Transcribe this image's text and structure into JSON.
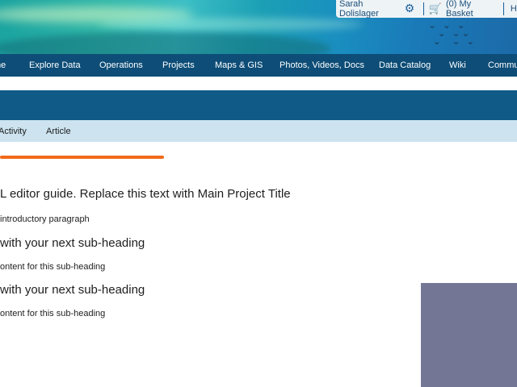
{
  "header": {
    "user_name": "Sarah Dolislager",
    "basket_label": "(0) My Basket",
    "help_label": "He",
    "icons": {
      "settings": "gear-icon",
      "cart": "cart-icon"
    }
  },
  "main_nav": {
    "items": [
      {
        "label": "me"
      },
      {
        "label": "Explore Data"
      },
      {
        "label": "Operations"
      },
      {
        "label": "Projects"
      },
      {
        "label": "Maps & GIS"
      },
      {
        "label": "Photos, Videos, Docs"
      },
      {
        "label": "Data Catalog"
      },
      {
        "label": "Wiki"
      },
      {
        "label": "Commu"
      }
    ]
  },
  "sub_nav": {
    "items": [
      {
        "label": "Activity"
      },
      {
        "label": "Article"
      }
    ]
  },
  "content": {
    "main_heading": "L editor guide. Replace this text with Main Project Title",
    "intro": "introductory paragraph",
    "sections": [
      {
        "heading": "with your next sub-heading",
        "body": "ontent for this sub-heading"
      },
      {
        "heading": "with your next sub-heading",
        "body": "ontent for this sub-heading"
      }
    ]
  },
  "colors": {
    "nav_bg": "#0d4d77",
    "title_bar": "#0f5a87",
    "subnav_bg": "#cde4f0",
    "accent": "#f26a1b",
    "side_box": "#737694"
  }
}
